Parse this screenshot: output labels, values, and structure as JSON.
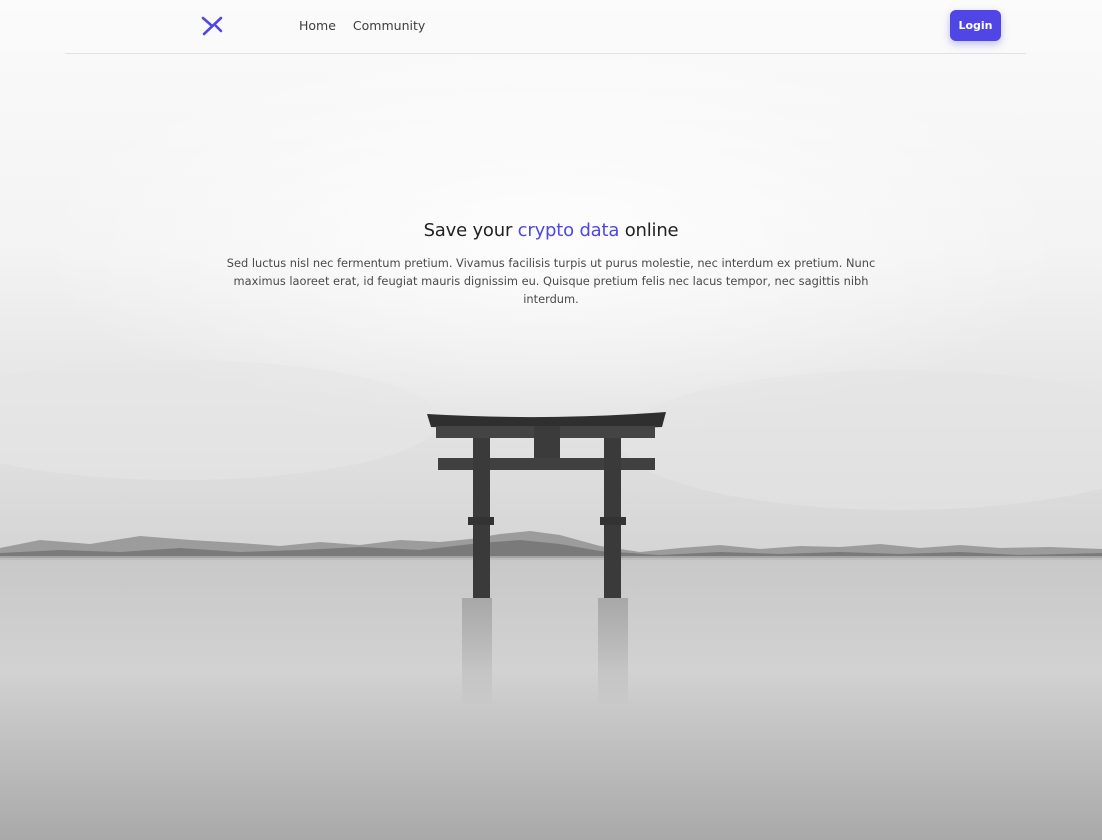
{
  "nav": {
    "logo_icon": "x-chevron-logo-icon",
    "links": [
      {
        "label": "Home"
      },
      {
        "label": "Community"
      }
    ],
    "login_label": "Login"
  },
  "hero": {
    "title_before": "Save your",
    "title_accent": "crypto data",
    "title_after": "online",
    "text": "Sed luctus nisl nec fermentum pretium. Vivamus facilisis turpis ut purus molestie, nec interdum ex pretium. Nunc maximus laoreet erat, id feugiat mauris dignissim eu. Quisque pretium felis nec lacus tempor, nec sagittis nibh interdum."
  },
  "colors": {
    "accent": "#4f46e5",
    "nav_text": "#3d3d3d",
    "heading_text": "#222222",
    "body_text": "#4a4a4a",
    "divider": "#e2e2e2"
  }
}
